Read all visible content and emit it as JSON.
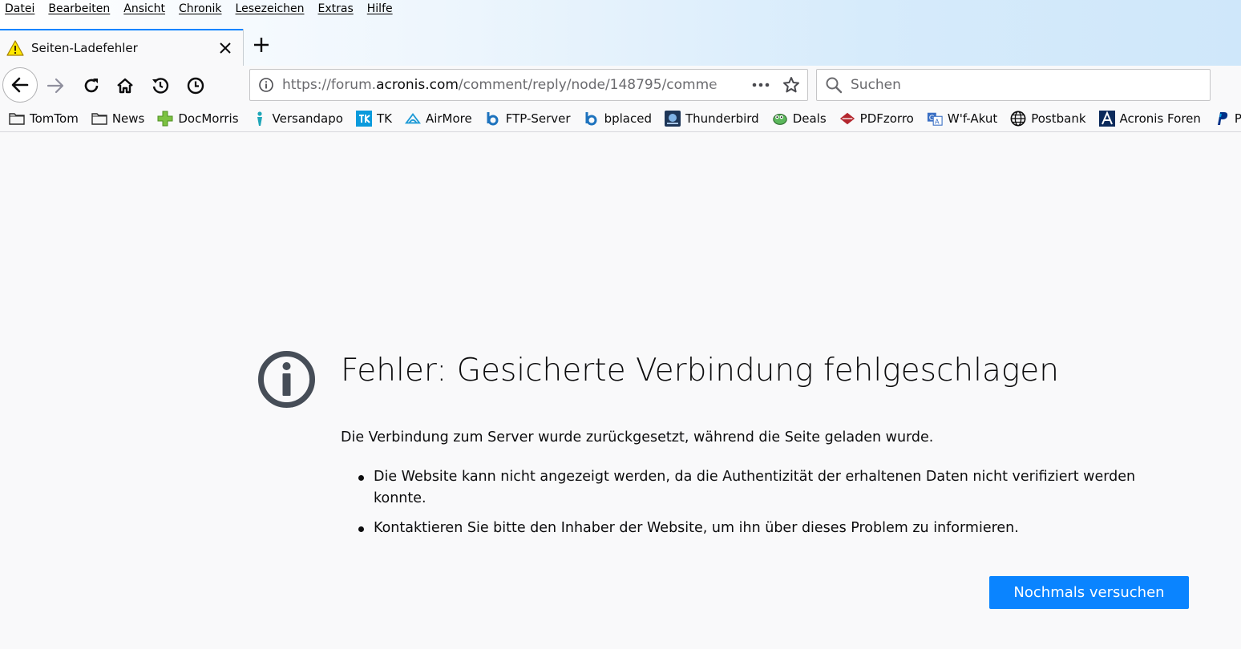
{
  "menubar": {
    "items": [
      "Datei",
      "Bearbeiten",
      "Ansicht",
      "Chronik",
      "Lesezeichen",
      "Extras",
      "Hilfe"
    ]
  },
  "tab": {
    "title": "Seiten-Ladefehler",
    "icon": "warning-icon"
  },
  "urlbar": {
    "prefix": "https://forum.",
    "host": "acronis.com",
    "path": "/comment/reply/node/148795/comme"
  },
  "search": {
    "placeholder": "Suchen"
  },
  "bookmarks": [
    {
      "label": "TomTom",
      "icon": "folder-icon"
    },
    {
      "label": "News",
      "icon": "folder-icon"
    },
    {
      "label": "DocMorris",
      "icon": "docmorris-icon"
    },
    {
      "label": "Versandapo",
      "icon": "versandapo-icon"
    },
    {
      "label": "TK",
      "icon": "tk-icon"
    },
    {
      "label": "AirMore",
      "icon": "airmore-icon"
    },
    {
      "label": "FTP-Server",
      "icon": "bplaced-icon"
    },
    {
      "label": "bplaced",
      "icon": "bplaced-icon"
    },
    {
      "label": "Thunderbird",
      "icon": "thunderbird-icon"
    },
    {
      "label": "Deals",
      "icon": "deals-icon"
    },
    {
      "label": "PDFzorro",
      "icon": "pdfzorro-icon"
    },
    {
      "label": "W'f-Akut",
      "icon": "wf-akut-icon"
    },
    {
      "label": "Postbank",
      "icon": "globe-icon"
    },
    {
      "label": "Acronis Foren",
      "icon": "acronis-icon"
    },
    {
      "label": "P",
      "icon": "paypal-icon"
    }
  ],
  "error": {
    "title": "Fehler: Gesicherte Verbindung fehlgeschlagen",
    "description": "Die Verbindung zum Server wurde zurückgesetzt, während die Seite geladen wurde.",
    "bullets": [
      "Die Website kann nicht angezeigt werden, da die Authentizität der erhaltenen Daten nicht verifiziert werden konnte.",
      "Kontaktieren Sie bitte den Inhaber der Website, um ihn über dieses Problem zu informieren."
    ],
    "retry_label": "Nochmals versuchen"
  },
  "colors": {
    "accent": "#0a84ff",
    "page_bg": "#f9f9fa",
    "icon_gray": "#4a4a4f"
  }
}
